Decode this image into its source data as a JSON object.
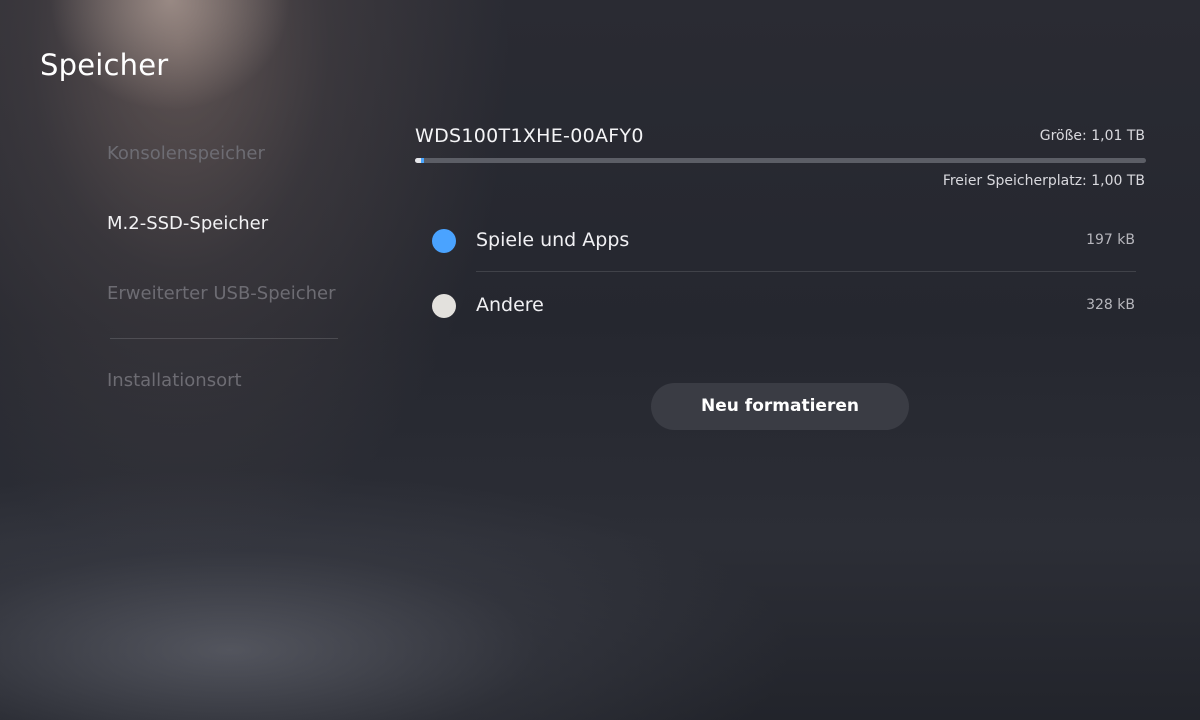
{
  "page": {
    "title": "Speicher"
  },
  "nav": {
    "items": [
      {
        "label": "Konsolenspeicher",
        "active": false
      },
      {
        "label": "M.2-SSD-Speicher",
        "active": true
      },
      {
        "label": "Erweiterter USB-Speicher",
        "active": false
      },
      {
        "label": "Installationsort",
        "active": false
      }
    ]
  },
  "drive": {
    "name": "WDS100T1XHE-00AFY0",
    "size": "Größe: 1,01 TB",
    "free": "Freier Speicherplatz: 1,00 TB",
    "used_fraction": 0.012
  },
  "categories": [
    {
      "label": "Spiele und Apps",
      "value": "197 kB",
      "color": "#4aa3ff"
    },
    {
      "label": "Andere",
      "value": "328 kB",
      "color": "#e3e1dd"
    }
  ],
  "actions": {
    "format_label": "Neu formatieren"
  },
  "colors": {
    "accent": "#4aa3ff",
    "button_bg": "#3a3c44"
  }
}
